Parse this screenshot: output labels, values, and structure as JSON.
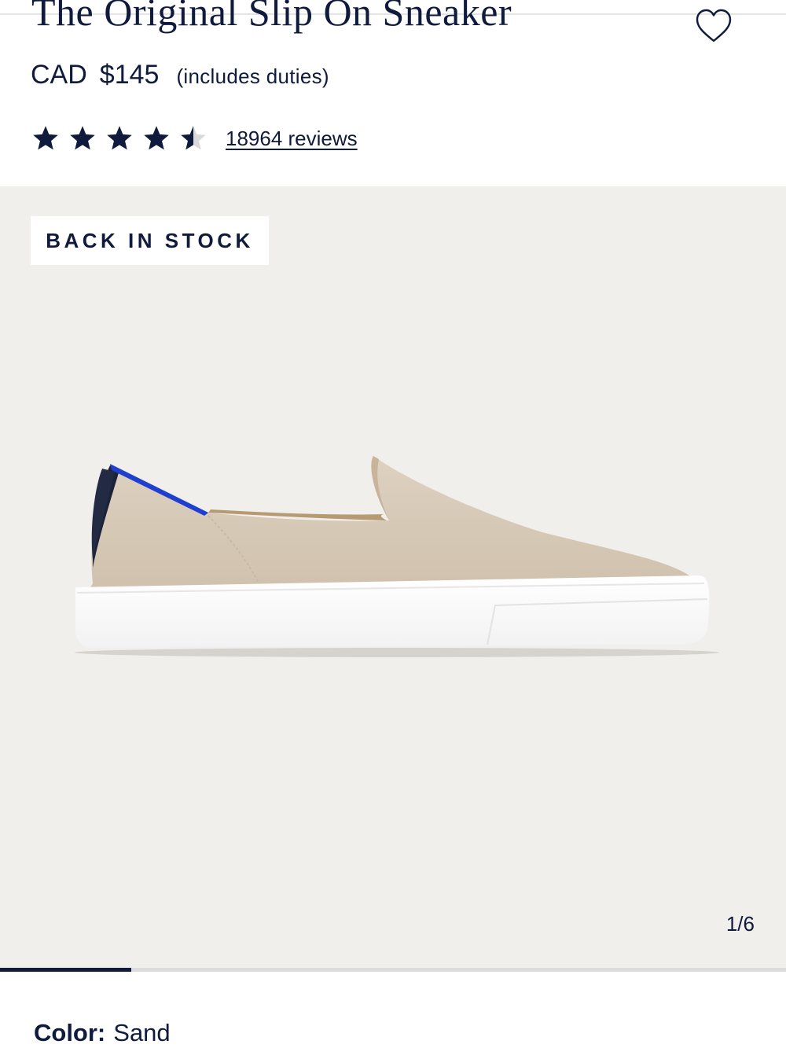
{
  "product": {
    "title": "The Original Slip On Sneaker",
    "currency": "CAD",
    "price": "$145",
    "duties_note": "(includes duties)",
    "rating": 4.5,
    "rating_max": 5,
    "reviews_text": "18964 reviews"
  },
  "gallery": {
    "badge": "BACK IN STOCK",
    "counter": "1/6",
    "current": 1,
    "total": 6
  },
  "color": {
    "label": "Color:",
    "value": "Sand"
  },
  "icons": {
    "favorite": "heart-outline-icon",
    "rating": "star-icon"
  },
  "colors": {
    "navy": "#0f1a3c",
    "gallery_bg": "#f1efec",
    "star_empty": "#d9d9d9",
    "shoe_knit": "#d6c9b7",
    "heel_blue": "#1f3fd0"
  }
}
